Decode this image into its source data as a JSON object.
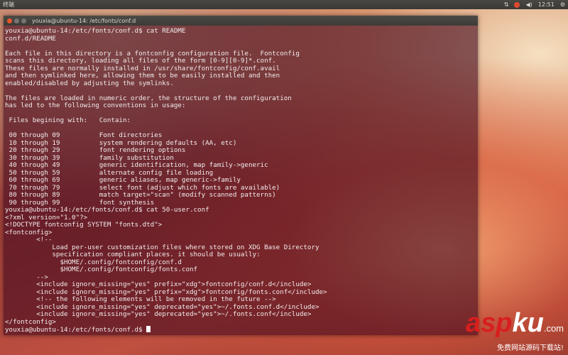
{
  "topbar": {
    "app_title": "终端",
    "clock": "12:51",
    "icons": [
      "network-icon",
      "mail-icon",
      "volume-icon",
      "power-icon"
    ]
  },
  "window": {
    "title": "youxia@ubuntu-14: /etc/fonts/conf.d"
  },
  "terminal": {
    "lines": [
      "youxia@ubuntu-14:/etc/fonts/conf.d$ cat README",
      "conf.d/README",
      "",
      "Each file in this directory is a fontconfig configuration file.  Fontconfig",
      "scans this directory, loading all files of the form [0-9][0-9]*.conf.",
      "These files are normally installed in /usr/share/fontconfig/conf.avail",
      "and then symlinked here, allowing them to be easily installed and then",
      "enabled/disabled by adjusting the symlinks.",
      "",
      "The files are loaded in numeric order, the structure of the configuration",
      "has led to the following conventions in usage:",
      "",
      " Files begining with:   Contain:",
      "",
      " 00 through 09          Font directories",
      " 10 through 19          system rendering defaults (AA, etc)",
      " 20 through 29          font rendering options",
      " 30 through 39          family substitution",
      " 40 through 49          generic identification, map family->generic",
      " 50 through 59          alternate config file loading",
      " 60 through 69          generic aliases, map generic->family",
      " 70 through 79          select font (adjust which fonts are available)",
      " 80 through 89          match target=\"scan\" (modify scanned patterns)",
      " 90 through 99          font synthesis",
      "youxia@ubuntu-14:/etc/fonts/conf.d$ cat 50-user.conf",
      "<?xml version=\"1.0\"?>",
      "<!DOCTYPE fontconfig SYSTEM \"fonts.dtd\">",
      "<fontconfig>",
      "        <!--",
      "            Load per-user customization files where stored on XDG Base Directory",
      "            specification compliant places. it should be usually:",
      "              $HOME/.config/fontconfig/conf.d",
      "              $HOME/.config/fontconfig/fonts.conf",
      "        -->",
      "        <include ignore_missing=\"yes\" prefix=\"xdg\">fontconfig/conf.d</include>",
      "        <include ignore_missing=\"yes\" prefix=\"xdg\">fontconfig/fonts.conf</include>",
      "        <!-- the following elements will be removed in the future -->",
      "        <include ignore_missing=\"yes\" deprecated=\"yes\">~/.fonts.conf.d</include>",
      "        <include ignore_missing=\"yes\" deprecated=\"yes\">~/.fonts.conf</include>",
      "</fontconfig>"
    ],
    "prompt": "youxia@ubuntu-14:/etc/fonts/conf.d$ "
  },
  "watermark": {
    "asp": "asp",
    "ku": "ku",
    "com": ".com",
    "subtitle": "免费网站源码下载站!"
  }
}
